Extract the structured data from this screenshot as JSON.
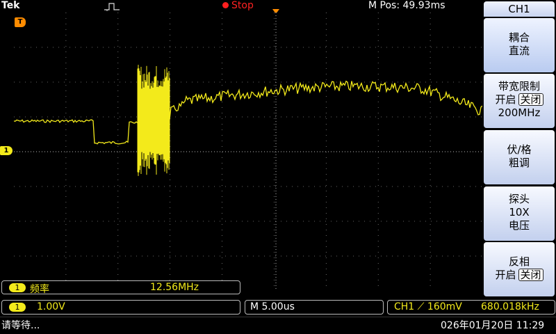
{
  "header": {
    "brand": "Tek",
    "run_state": "Stop",
    "mpos": "M Pos: 49.93ms"
  },
  "colors": {
    "trace": "#f3ea1b",
    "stop": "#ff2222",
    "trigger_marker": "#ff8c00",
    "grid": "#c8c8c8"
  },
  "icons": {
    "trigger_marker": "T",
    "channel_marker": "1",
    "trigger_position": "orange-triangle-icon"
  },
  "side_menu": {
    "title": "CH1",
    "buttons": [
      {
        "line1": "耦合",
        "line2": "直流"
      },
      {
        "line1": "带宽限制",
        "line2": "开启",
        "boxed": "关闭",
        "line3": "200MHz"
      },
      {
        "line1": "伏/格",
        "line2": "粗调"
      },
      {
        "line1": "探头",
        "line2": "10X",
        "line3": "电压"
      },
      {
        "line1": "反相",
        "line2": "开启",
        "boxed": "关闭"
      }
    ]
  },
  "measurement": {
    "channel": "1",
    "label": "频率",
    "value": "12.56MHz"
  },
  "status_bar": {
    "channel": "1",
    "volts_per_div": "1.00V",
    "time_per_div": "M 5.00us",
    "trigger": "CH1 ⟋ 160mV",
    "trigger_freq": "680.018kHz"
  },
  "footer": {
    "message": "请等待...",
    "datetime": "026年01月20日 11:29"
  }
}
